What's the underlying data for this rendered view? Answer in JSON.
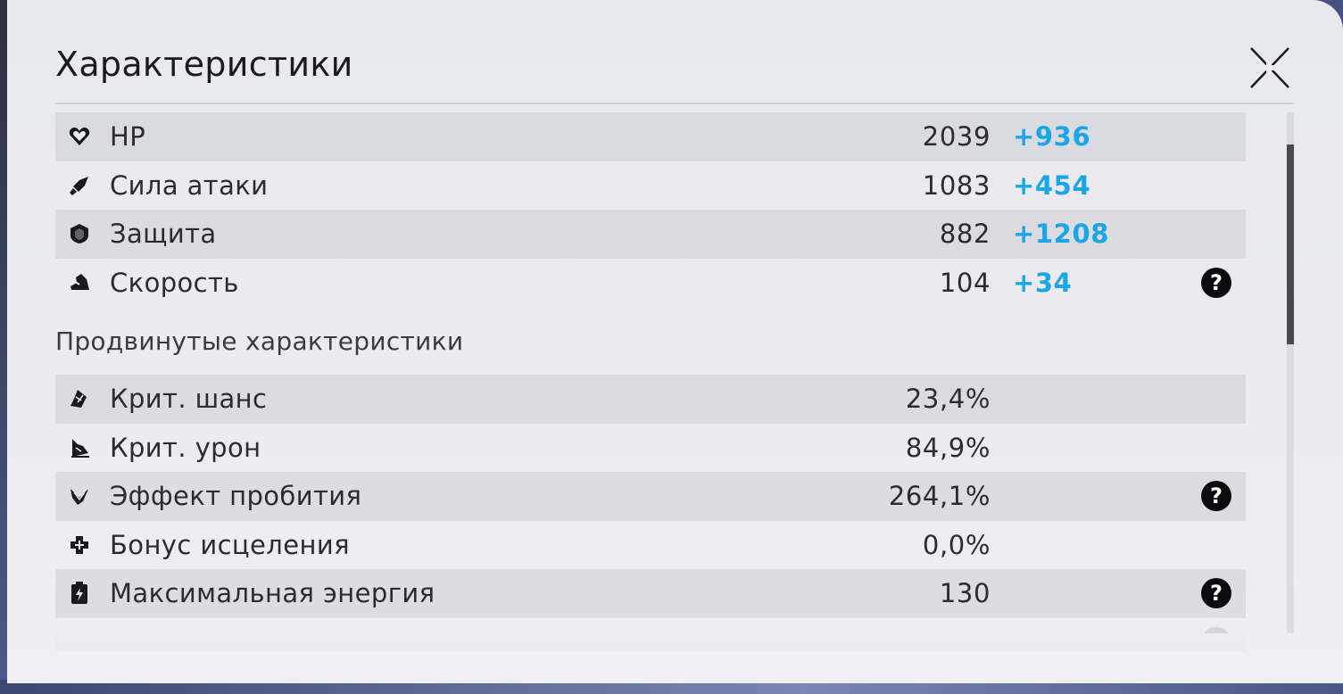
{
  "dialog": {
    "title": "Характеристики",
    "close_icon": "close-x-icon"
  },
  "base_stats": [
    {
      "icon": "heart-icon",
      "label": "HP",
      "value": "2039",
      "bonus": "+936",
      "help": false
    },
    {
      "icon": "sword-icon",
      "label": "Сила атаки",
      "value": "1083",
      "bonus": "+454",
      "help": false
    },
    {
      "icon": "shield-icon",
      "label": "Защита",
      "value": "882",
      "bonus": "+1208",
      "help": false
    },
    {
      "icon": "boot-speed-icon",
      "label": "Скорость",
      "value": "104",
      "bonus": "+34",
      "help": true
    }
  ],
  "advanced_section": {
    "title": "Продвинутые характеристики"
  },
  "advanced_stats": [
    {
      "icon": "crit-chance-icon",
      "label": "Крит. шанс",
      "value": "23,4%",
      "help": false
    },
    {
      "icon": "crit-damage-icon",
      "label": "Крит. урон",
      "value": "84,9%",
      "help": false
    },
    {
      "icon": "break-effect-icon",
      "label": "Эффект пробития",
      "value": "264,1%",
      "help": true
    },
    {
      "icon": "healing-cross-icon",
      "label": "Бонус исцеления",
      "value": "0,0%",
      "help": false
    },
    {
      "icon": "energy-icon",
      "label": "Максимальная энергия",
      "value": "130",
      "help": true
    }
  ],
  "help_glyph": "?",
  "colors": {
    "bonus": "#1aa6e8",
    "panel": "#ececf0",
    "text": "#2b2b30"
  }
}
